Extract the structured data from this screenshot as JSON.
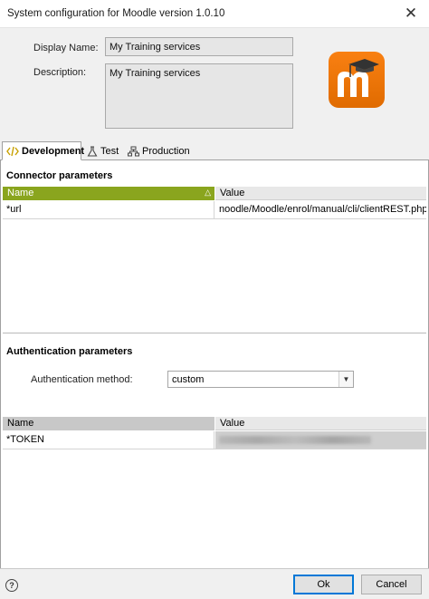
{
  "window": {
    "title": "System configuration for Moodle version 1.0.10",
    "close_glyph": "✕"
  },
  "header": {
    "display_name_label": "Display Name:",
    "display_name_value": "My Training services",
    "description_label": "Description:",
    "description_value": "My Training services",
    "logo_icon": "moodle-logo",
    "logo_color": "#f98012"
  },
  "tabs": [
    {
      "label": "Development",
      "icon": "code-icon",
      "active": true
    },
    {
      "label": "Test",
      "icon": "flask-icon",
      "active": false
    },
    {
      "label": "Production",
      "icon": "network-icon",
      "active": false
    }
  ],
  "connector": {
    "title": "Connector parameters",
    "col_name": "Name",
    "col_value": "Value",
    "sort_glyph": "△",
    "header_color": "#8aa51e",
    "rows": [
      {
        "name": "*url",
        "value": "noodle/Moodle/enrol/manual/cli/clientREST.php"
      }
    ]
  },
  "auth": {
    "title": "Authentication parameters",
    "method_label": "Authentication method:",
    "method_value": "custom",
    "col_name": "Name",
    "col_value": "Value",
    "rows": [
      {
        "name": "*TOKEN",
        "value": ""
      }
    ]
  },
  "footer": {
    "help_glyph": "?",
    "ok_label": "Ok",
    "cancel_label": "Cancel"
  }
}
